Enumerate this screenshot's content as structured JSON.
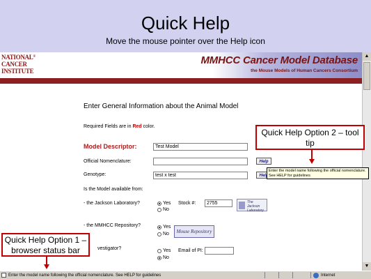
{
  "slide": {
    "title": "Quick Help",
    "subtitle": "Move the mouse pointer over the Help icon"
  },
  "banner": {
    "nci_line1": "NATIONAL",
    "nci_line2": "CANCER",
    "nci_line3": "INSTITUTE",
    "nci_reg": "®",
    "db_title": "MMHCC  Cancer Model Database",
    "db_subtitle": "the Mouse Models of Human Cancers Consortium"
  },
  "form": {
    "section_title": "Enter General Information about the Animal Model",
    "required_prefix": "Required Fields are in ",
    "required_color_word": "Red",
    "required_suffix": " color.",
    "model_descriptor_label": "Model Descriptor:",
    "model_descriptor_value": "Test Model",
    "official_nomenclature_label": "Official Nomenclature:",
    "official_nomenclature_value": "",
    "genotype_label": "Genotype:",
    "genotype_value": "test x test",
    "help_label": "Help",
    "availability_question": "Is the Model available from:",
    "jackson_label": "- the Jackson Laboratory?",
    "mmhcc_label": "- the MMHCC Repository?",
    "investigator_label": "vestigator?",
    "yes_label": "Yes",
    "no_label": "No",
    "stock_label": "Stock #:",
    "stock_value": "2755",
    "email_label": "Email of PI:",
    "email_value": "",
    "jax_logo_text": "The Jackson Laboratory",
    "repository_logo_text": "Mouse Repository"
  },
  "tooltip": {
    "text": "Enter the model name following the official nomenclature. See HELP for guidelines"
  },
  "callouts": {
    "option2": "Quick Help Option 2 – tool tip",
    "option1": "Quick Help Option 1 – browser status bar"
  },
  "statusbar": {
    "text": "Enter the model name following the official nomenclature. See HELP for guidelines",
    "zone": "Internet"
  },
  "colors": {
    "slide_bg": "#d2d2f0",
    "required_red": "#c00000",
    "banner_red": "#8c1f1f"
  }
}
